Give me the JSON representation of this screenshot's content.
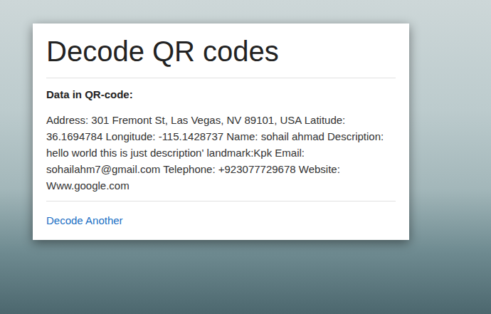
{
  "page": {
    "title": "Decode QR codes"
  },
  "result": {
    "label": "Data in QR-code:",
    "text": "Address: 301 Fremont St, Las Vegas, NV 89101, USA Latitude: 36.1694784 Longitude: -115.1428737 Name: sohail ahmad Description: hello world this is just description' landmark:Kpk Email: sohailahm7@gmail.com Telephone: +923077729678 Website: Www.google.com"
  },
  "actions": {
    "link": "Decode Another"
  }
}
